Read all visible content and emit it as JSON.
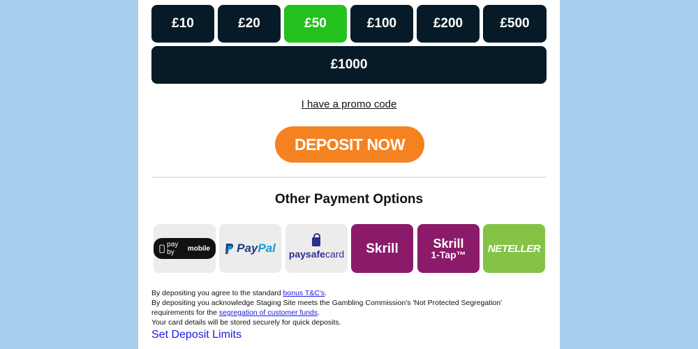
{
  "amounts": [
    "£10",
    "£20",
    "£50",
    "£100",
    "£200",
    "£500",
    "£1000"
  ],
  "selected_amount": "£50",
  "promo_link": "I have a promo code",
  "deposit_button": "DEPOSIT NOW",
  "other_payment": {
    "title": "Other Payment Options",
    "methods": {
      "paybymobile": {
        "pre": "pay by",
        "bold": "mobile"
      },
      "paypal": {
        "pay": "Pay",
        "pal": "Pal"
      },
      "paysafecard": {
        "bold": "paysafe",
        "light": "card"
      },
      "skrill": "Skrill",
      "skrill_1tap": {
        "line1": "Skrill",
        "line2": "1-Tap™"
      },
      "neteller": "NETELLER"
    }
  },
  "legal": {
    "line1_pre": "By depositing you agree to the standard ",
    "line1_link": "bonus T&C's",
    "line1_post": ".",
    "line2": "By depositing you acknowledge Staging Site meets the Gambling Commission's 'Not Protected Segregation'",
    "line3_pre": "requirements for the ",
    "line3_link": "segregation of customer funds",
    "line3_post": ".",
    "line4": "Your card details will be stored securely for quick deposits."
  },
  "limits_link": "Set Deposit Limits",
  "colors": {
    "background": "#a9cfee",
    "amount_bg": "#061b27",
    "selected": "#25c11f",
    "deposit": "#f58220",
    "skrill": "#8b1a6a",
    "neteller": "#84c346",
    "link": "#1a1adb"
  }
}
